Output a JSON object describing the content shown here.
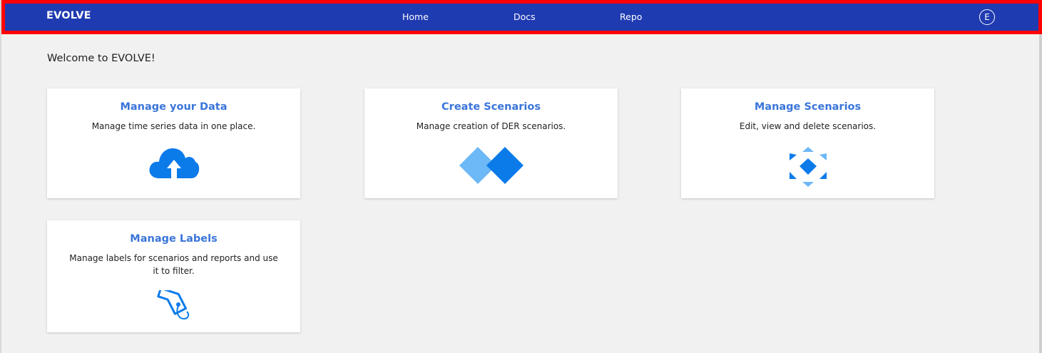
{
  "header": {
    "brand": "EVOLVE",
    "nav": [
      "Home",
      "Docs",
      "Repo"
    ],
    "avatar_initial": "E",
    "bar_color": "#1f3bb1",
    "highlight_border_color": "#ff0000"
  },
  "main": {
    "welcome": "Welcome to EVOLVE!",
    "cards": [
      {
        "title": "Manage your Data",
        "description": "Manage time series data in one place.",
        "icon": "cloud-upload-icon"
      },
      {
        "title": "Create Scenarios",
        "description": "Manage creation of DER scenarios.",
        "icon": "diamonds-icon"
      },
      {
        "title": "Manage Scenarios",
        "description": "Edit, view and delete scenarios.",
        "icon": "scenario-cluster-icon"
      },
      {
        "title": "Manage Labels",
        "description": "Manage labels for scenarios and reports and use it to filter.",
        "icon": "tag-icon"
      }
    ],
    "accent_color": "#3a75d9",
    "icon_color": "#0b7bea"
  }
}
